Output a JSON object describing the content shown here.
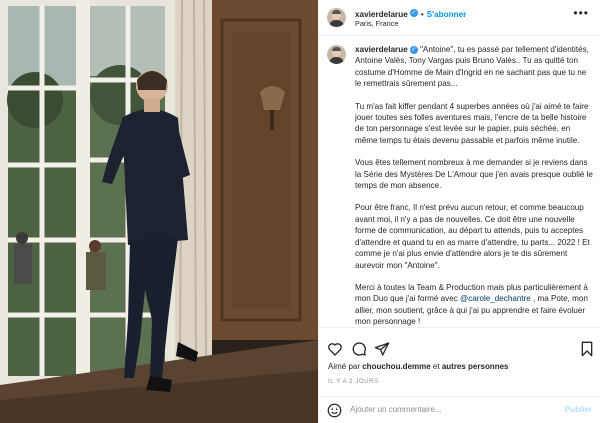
{
  "post": {
    "username": "xavierdelarue",
    "follow_label": "S'abonner",
    "location": "Paris, France",
    "more_icon": "more-options-icon",
    "caption": {
      "p1": "\"Antoine\", tu es passé par tellement d'identités, Antoine Valès, Tony Vargas puis Bruno Valès.. Tu as quitté ton costume d'Homme de Main d'Ingrid en ne sachant pas que tu ne le remettrais sûrement pas...",
      "p2": "Tu m'as fait kiffer pendant 4 superbes années où j'ai aimé te faire jouer toutes ses folles aventures mais, l'encre de ta belle histoire de ton personnage s'est levée sur le papier, puis séchée, en même temps tu étais devenu passable et parfois même inutile.",
      "p3": "Vous êtes tellement nombreux à me demander si je reviens dans la Série des Mystères De L'Amour que j'en avais presque oublié le temps de mon absence.",
      "p4": "Pour être franc, Il n'est prévu aucun retour, et comme beaucoup avant moi, il n'y a pas de nouvelles. Ce doit être une nouvelle forme de communication, au départ tu attends, puis tu acceptes d'attendre et quand tu en as marre d'attendre, tu parts... 2022 ! Et comme je n'ai plus envie d'attendre alors je te dis sûrement aurevoir mon \"Antoine\".",
      "p5_before": "Merci à toutes la Team & Production mais plus particulièrement à mon Duo que j'ai formé avec ",
      "p5_mention": "@carole_dechantre",
      "p5_after": " , ma Pote, mon allier, mon soutient, grâce à qui j'ai pu apprendre et faire évoluer mon personnage !"
    },
    "likes": {
      "prefix": "Aimé par ",
      "user": "chouchou.demme",
      "middle": " et ",
      "others": "autres personnes"
    },
    "time": "IL Y A 2 JOURS",
    "comment_placeholder": "Ajouter un commentaire...",
    "publish_label": "Publier"
  },
  "icons": {
    "like": "heart-icon",
    "comment": "comment-icon",
    "share": "share-icon",
    "save": "bookmark-icon",
    "emoji": "emoji-icon"
  },
  "colors": {
    "link_blue": "#0095f6",
    "verified_blue": "#3897f0",
    "publish_disabled": "#b2dffc",
    "muted": "#8e8e8e"
  }
}
